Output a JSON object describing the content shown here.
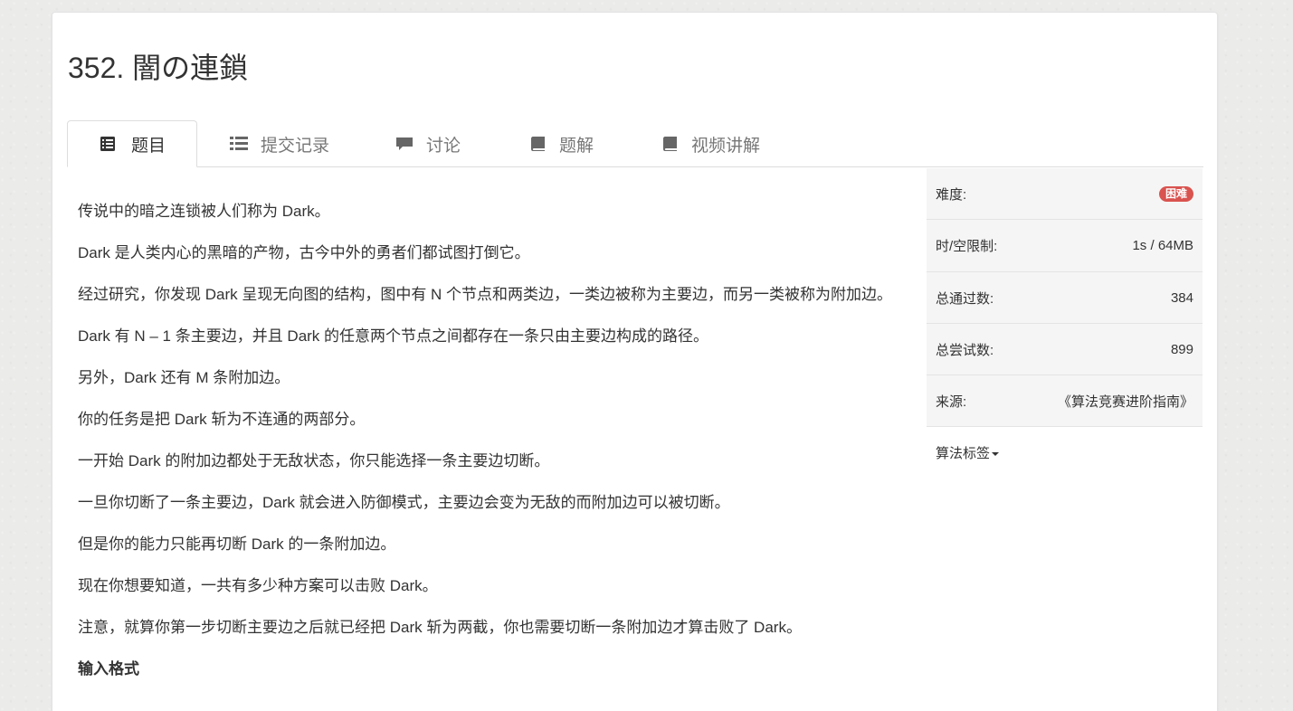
{
  "problem": {
    "title": "352. 闇の連鎖"
  },
  "tabs": [
    {
      "label": "题目",
      "icon": "list-alt-icon",
      "active": true
    },
    {
      "label": "提交记录",
      "icon": "list-icon",
      "active": false
    },
    {
      "label": "讨论",
      "icon": "comment-icon",
      "active": false
    },
    {
      "label": "题解",
      "icon": "book-icon",
      "active": false
    },
    {
      "label": "视频讲解",
      "icon": "book-icon",
      "active": false
    }
  ],
  "description": [
    "传说中的暗之连锁被人们称为 Dark。",
    "Dark 是人类内心的黑暗的产物，古今中外的勇者们都试图打倒它。",
    "经过研究，你发现 Dark 呈现无向图的结构，图中有 N 个节点和两类边，一类边被称为主要边，而另一类被称为附加边。",
    "Dark 有 N – 1 条主要边，并且 Dark 的任意两个节点之间都存在一条只由主要边构成的路径。",
    "另外，Dark 还有 M 条附加边。",
    "你的任务是把 Dark 斩为不连通的两部分。",
    "一开始 Dark 的附加边都处于无敌状态，你只能选择一条主要边切断。",
    "一旦你切断了一条主要边，Dark 就会进入防御模式，主要边会变为无敌的而附加边可以被切断。",
    "但是你的能力只能再切断 Dark 的一条附加边。",
    "现在你想要知道，一共有多少种方案可以击败 Dark。",
    "注意，就算你第一步切断主要边之后就已经把 Dark 斩为两截，你也需要切断一条附加边才算击败了 Dark。"
  ],
  "input_heading": "输入格式",
  "sidebar": {
    "difficulty_label": "难度:",
    "difficulty_value": "困难",
    "difficulty_color": "#d9534f",
    "limit_label": "时/空限制:",
    "limit_value": "1s / 64MB",
    "accepted_label": "总通过数:",
    "accepted_value": "384",
    "attempts_label": "总尝试数:",
    "attempts_value": "899",
    "source_label": "来源:",
    "source_value": "《算法竞赛进阶指南》",
    "tags_label": "算法标签"
  }
}
